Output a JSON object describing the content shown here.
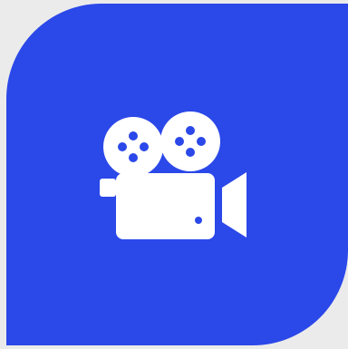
{
  "colors": {
    "background": "#ebebeb",
    "tile": "#2b48e9",
    "icon": "#ffffff"
  },
  "icon": {
    "name": "movie-camera-icon"
  }
}
